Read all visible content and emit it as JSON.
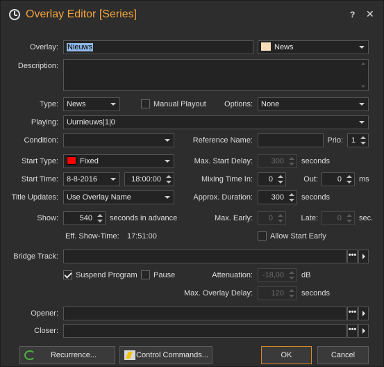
{
  "window": {
    "title": "Overlay Editor [Series]",
    "help": "?",
    "close": "✕"
  },
  "overlay": {
    "label": "Overlay:",
    "value": "Nieuws",
    "category": "News",
    "category_color": "#f6deb9"
  },
  "description": {
    "label": "Description:",
    "value": ""
  },
  "type": {
    "label": "Type:",
    "value": "News"
  },
  "manual_playout": {
    "label": "Manual Playout",
    "checked": false
  },
  "options": {
    "label": "Options:",
    "value": "None"
  },
  "playing": {
    "label": "Playing:",
    "value": "Uurnieuws|1|0"
  },
  "condition": {
    "label": "Condition:",
    "value": ""
  },
  "reference_name": {
    "label": "Reference Name:",
    "value": ""
  },
  "prio": {
    "label": "Prio:",
    "value": "1"
  },
  "start_type": {
    "label": "Start Type:",
    "value": "Fixed",
    "color": "#ff0000"
  },
  "max_start_delay": {
    "label": "Max. Start Delay:",
    "value": "300",
    "unit": "seconds"
  },
  "start_time": {
    "label": "Start Time:",
    "date": "8-8-2016",
    "time": "18:00:00"
  },
  "mixing_time_in": {
    "label": "Mixing Time In:",
    "value": "0"
  },
  "out": {
    "label": "Out:",
    "value": "0",
    "unit": "ms"
  },
  "title_updates": {
    "label": "Title Updates:",
    "value": "Use Overlay Name"
  },
  "approx_duration": {
    "label": "Approx. Duration:",
    "value": "300",
    "unit": "seconds"
  },
  "show": {
    "label": "Show:",
    "value": "540",
    "unit": "seconds in advance"
  },
  "max_early": {
    "label": "Max. Early:",
    "value": "0"
  },
  "late": {
    "label": "Late:",
    "value": "0",
    "unit": "sec."
  },
  "eff_show_time": {
    "label": "Eff. Show-Time:",
    "value": "17:51:00"
  },
  "allow_start_early": {
    "label": "Allow Start Early",
    "checked": false
  },
  "bridge_track": {
    "label": "Bridge Track:",
    "value": ""
  },
  "suspend_program": {
    "label": "Suspend Program",
    "checked": true
  },
  "pause": {
    "label": "Pause",
    "checked": false
  },
  "attenuation": {
    "label": "Attenuation:",
    "value": "-18,00",
    "unit": "dB"
  },
  "max_overlay_delay": {
    "label": "Max. Overlay Delay:",
    "value": "120",
    "unit": "seconds"
  },
  "opener": {
    "label": "Opener:",
    "value": ""
  },
  "closer": {
    "label": "Closer:",
    "value": ""
  },
  "browse_glyph": "•••",
  "buttons": {
    "recurrence": "Recurrence...",
    "control_commands": "Control Commands...",
    "ok": "OK",
    "cancel": "Cancel"
  }
}
